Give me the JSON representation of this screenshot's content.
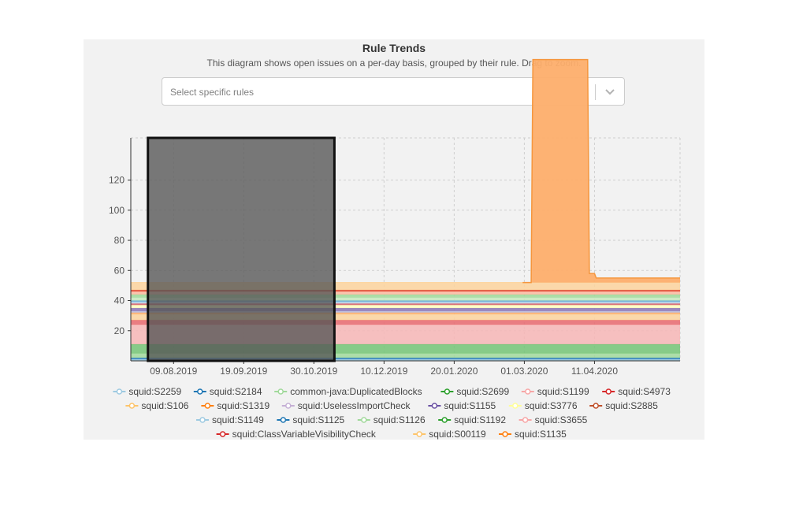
{
  "header": {
    "title": "Rule Trends",
    "subtitle": "This diagram shows open issues on a per-day basis, grouped by their rule. Drag to zoom."
  },
  "rule_select": {
    "placeholder": "Select specific rules"
  },
  "chart_data": {
    "type": "area",
    "stacked": true,
    "x_range": [
      "2019-07-15",
      "2020-05-31"
    ],
    "x_ticks": [
      "09.08.2019",
      "19.09.2019",
      "30.10.2019",
      "10.12.2019",
      "20.01.2020",
      "01.03.2020",
      "11.04.2020"
    ],
    "ylim": [
      0,
      148
    ],
    "y_ticks": [
      20,
      40,
      60,
      80,
      100,
      120
    ],
    "grid": true,
    "legend": "bottom",
    "zoom_selection": [
      "2019-07-25",
      "2019-11-11"
    ],
    "series": [
      {
        "name": "squid:S2259",
        "color": "#9ecae1",
        "values": [
          1,
          1
        ]
      },
      {
        "name": "squid:S2184",
        "color": "#3182bd",
        "values": [
          1,
          1
        ]
      },
      {
        "name": "common-java:DuplicatedBlocks",
        "color": "#a1d99b",
        "values": [
          3,
          3
        ]
      },
      {
        "name": "squid:S2699",
        "color": "#74c476",
        "values": [
          6,
          6
        ]
      },
      {
        "name": "squid:S1199",
        "color": "#f7b6b6",
        "values": [
          13,
          13
        ]
      },
      {
        "name": "squid:S4973",
        "color": "#e8686f",
        "values": [
          3,
          3
        ]
      },
      {
        "name": "squid:S106",
        "color": "#fdd49e",
        "values": [
          4,
          4
        ]
      },
      {
        "name": "squid:S1319",
        "color": "#fdae6b",
        "values": [
          1,
          1
        ]
      },
      {
        "name": "squid:UselessImportCheck",
        "color": "#bcbddc",
        "values": [
          1,
          1
        ]
      },
      {
        "name": "squid:S1155",
        "color": "#8c76b7",
        "values": [
          2,
          2
        ]
      },
      {
        "name": "squid:S3776",
        "color": "#ffffbf",
        "values": [
          2,
          2
        ]
      },
      {
        "name": "squid:S2885",
        "color": "#d6616b",
        "values": [
          1,
          1
        ]
      },
      {
        "name": "squid:S1149",
        "color": "#c6dbef",
        "values": [
          1,
          1
        ]
      },
      {
        "name": "squid:S1125",
        "color": "#6baed6",
        "values": [
          1,
          1
        ]
      },
      {
        "name": "squid:S1126",
        "color": "#c7e9c0",
        "values": [
          2,
          2
        ]
      },
      {
        "name": "squid:S1192",
        "color": "#a1d99b",
        "values": [
          2,
          2
        ]
      },
      {
        "name": "squid:S3655",
        "color": "#fcbba1",
        "values": [
          2,
          2
        ]
      },
      {
        "name": "squid:ClassVariableVisibilityCheck",
        "color": "#e34a33",
        "values": [
          1,
          1
        ]
      },
      {
        "name": "squid:S00119",
        "color": "#fdd49e",
        "values": [
          5,
          5
        ]
      },
      {
        "name": "squid:S1135",
        "color": "#fdae6b",
        "values": [
          0,
          0
        ]
      }
    ],
    "spike": {
      "series": "squid:S1135",
      "points": [
        [
          "2020-02-29",
          0
        ],
        [
          "2020-03-05",
          0
        ],
        [
          "2020-03-06",
          148
        ],
        [
          "2020-04-07",
          148
        ],
        [
          "2020-04-08",
          6
        ],
        [
          "2020-04-11",
          6
        ],
        [
          "2020-04-12",
          3
        ],
        [
          "2020-05-31",
          3
        ]
      ]
    }
  },
  "legend": {
    "rows": [
      [
        {
          "label": "squid:S2259",
          "color": "#9ecae1"
        },
        {
          "label": "squid:S2184",
          "color": "#1f77b4"
        },
        {
          "label": "common-java:DuplicatedBlocks",
          "color": "#a1d99b"
        },
        {
          "label": "squid:S2699",
          "color": "#2ca02c"
        },
        {
          "label": "squid:S1199",
          "color": "#f7a6a6"
        },
        {
          "label": "squid:S4973",
          "color": "#d62728"
        }
      ],
      [
        {
          "label": "squid:S106",
          "color": "#fdc46b"
        },
        {
          "label": "squid:S1319",
          "color": "#ff7f0e"
        },
        {
          "label": "squid:UselessImportCheck",
          "color": "#c5b0d5"
        },
        {
          "label": "squid:S1155",
          "color": "#6a51a3"
        },
        {
          "label": "squid:S3776",
          "color": "#ffff99"
        },
        {
          "label": "squid:S2885",
          "color": "#c0502a"
        }
      ],
      [
        {
          "label": "squid:S1149",
          "color": "#9ecae1"
        },
        {
          "label": "squid:S1125",
          "color": "#1f77b4"
        },
        {
          "label": "squid:S1126",
          "color": "#a1d99b"
        },
        {
          "label": "squid:S1192",
          "color": "#2ca02c"
        },
        {
          "label": "squid:S3655",
          "color": "#f7a6a6"
        }
      ],
      [
        {
          "label": "squid:ClassVariableVisibilityCheck",
          "color": "#d62728"
        },
        {
          "label": "squid:S00119",
          "color": "#fdc46b"
        },
        {
          "label": "squid:S1135",
          "color": "#ff7f0e"
        }
      ]
    ]
  }
}
